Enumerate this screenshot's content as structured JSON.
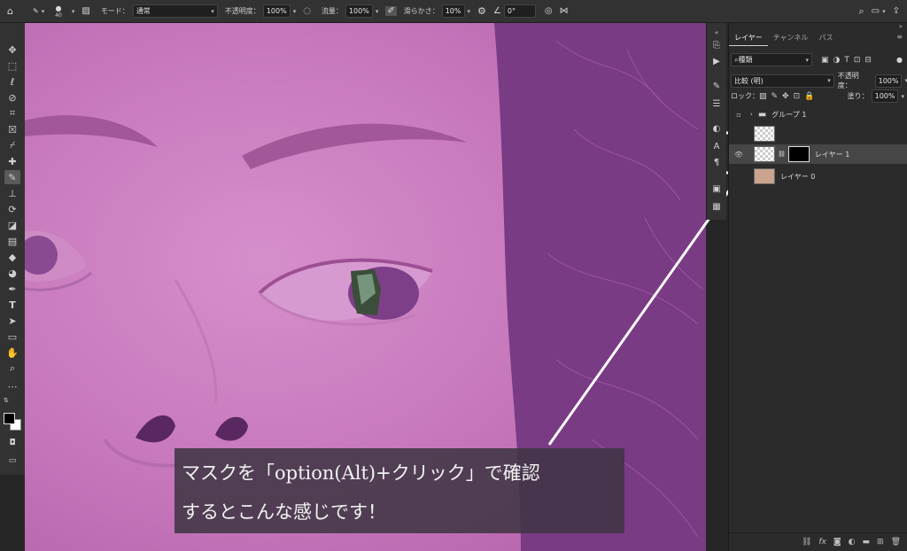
{
  "options_bar": {
    "brush_size": "40",
    "mode_label": "モード：",
    "mode_value": "通常",
    "opacity_label": "不透明度：",
    "opacity_value": "100%",
    "flow_label": "流量：",
    "flow_value": "100%",
    "smoothing_label": "滑らかさ：",
    "smoothing_value": "10%",
    "angle_value": "0°"
  },
  "layers_panel": {
    "tabs": [
      "レイヤー",
      "チャンネル",
      "パス"
    ],
    "filter_value": "種類",
    "blend_mode_value": "比較 (明)",
    "opacity_label": "不透明度：",
    "opacity_value": "100%",
    "lock_label": "ロック：",
    "fill_label": "塗り：",
    "fill_value": "100%",
    "layers": [
      {
        "name": "グループ 1"
      },
      {
        "name": ""
      },
      {
        "name": "レイヤー 1"
      },
      {
        "name": "レイヤー 0"
      }
    ]
  },
  "caption": {
    "line1": "マスクを「option(Alt)+クリック」で確認",
    "line2": "するとこんな感じです！"
  },
  "colors": {
    "canvas_overlay": "#b35ea9",
    "caption_bg": "#3e3442"
  }
}
